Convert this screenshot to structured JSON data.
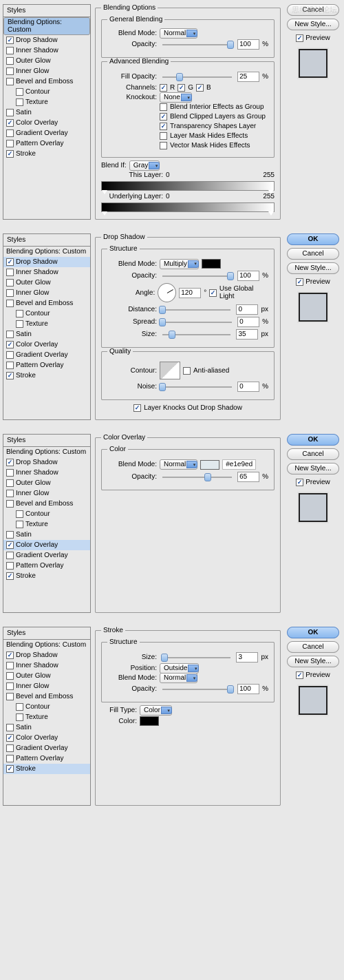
{
  "watermark": "思缘设计论坛",
  "common": {
    "styles_header": "Styles",
    "options": "Blending Options: Custom",
    "effects": [
      "Drop Shadow",
      "Inner Shadow",
      "Outer Glow",
      "Inner Glow",
      "Bevel and Emboss",
      "Contour",
      "Texture",
      "Satin",
      "Color Overlay",
      "Gradient Overlay",
      "Pattern Overlay",
      "Stroke"
    ],
    "checked": {
      "Drop Shadow": true,
      "Color Overlay": true,
      "Stroke": true
    },
    "ok": "OK",
    "cancel": "Cancel",
    "newstyle": "New Style...",
    "preview": "Preview"
  },
  "blend_mode_lbl": "Blend Mode:",
  "opacity_lbl": "Opacity:",
  "pct": "%",
  "px": "px",
  "p1": {
    "title": "Blending Options",
    "gb": {
      "title": "General Blending",
      "mode": "Normal",
      "opacity": "100"
    },
    "ab": {
      "title": "Advanced Blending",
      "fill_lbl": "Fill Opacity:",
      "fill": "25",
      "channels_lbl": "Channels:",
      "r": "R",
      "g": "G",
      "b": "B",
      "knock_lbl": "Knockout:",
      "knock": "None",
      "cb1": "Blend Interior Effects as Group",
      "cb2": "Blend Clipped Layers as Group",
      "cb3": "Transparency Shapes Layer",
      "cb4": "Layer Mask Hides Effects",
      "cb5": "Vector Mask Hides Effects"
    },
    "bi": {
      "lbl": "Blend If:",
      "val": "Gray",
      "this": "This Layer:",
      "under": "Underlying Layer:",
      "v0": "0",
      "v255": "255"
    }
  },
  "p2": {
    "title": "Drop Shadow",
    "struct": "Structure",
    "mode": "Multiply",
    "opacity": "100",
    "angle_lbl": "Angle:",
    "angle": "120",
    "ugl": "Use Global Light",
    "dist_lbl": "Distance:",
    "dist": "0",
    "spread_lbl": "Spread:",
    "spread": "0",
    "size_lbl": "Size:",
    "size": "35",
    "quality": "Quality",
    "contour_lbl": "Contour:",
    "aa": "Anti-aliased",
    "noise_lbl": "Noise:",
    "noise": "0",
    "knock": "Layer Knocks Out Drop Shadow"
  },
  "p3": {
    "title": "Color Overlay",
    "color": "Color",
    "mode": "Normal",
    "hex": "#e1e9ed",
    "opacity": "65"
  },
  "p4": {
    "title": "Stroke",
    "struct": "Structure",
    "size_lbl": "Size:",
    "size": "3",
    "pos_lbl": "Position:",
    "pos": "Outside",
    "mode": "Normal",
    "opacity": "100",
    "ft_lbl": "Fill Type:",
    "ft": "Color",
    "color_lbl": "Color:"
  }
}
